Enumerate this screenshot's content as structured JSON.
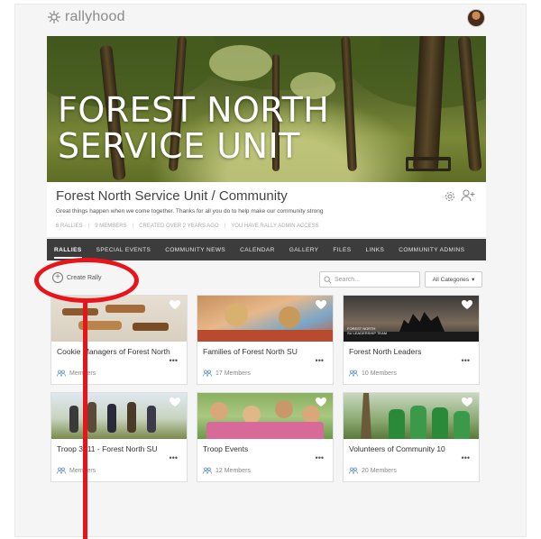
{
  "app": {
    "logo_text": "rallyhood"
  },
  "hero": {
    "line1": "FOREST NORTH",
    "line2": "SERVICE UNIT"
  },
  "community": {
    "title": "Forest North Service Unit / Community",
    "tagline": "Great things happen when we come together. Thanks for all you do to help make our community strong",
    "meta": [
      "6 RALLIES",
      "9 MEMBERS",
      "CREATED OVER 2 YEARS AGO",
      "YOU HAVE RALLY ADMIN ACCESS"
    ]
  },
  "tabs": [
    {
      "label": "RALLIES",
      "active": true
    },
    {
      "label": "SPECIAL EVENTS",
      "active": false
    },
    {
      "label": "COMMUNITY NEWS",
      "active": false
    },
    {
      "label": "CALENDAR",
      "active": false
    },
    {
      "label": "GALLERY",
      "active": false
    },
    {
      "label": "FILES",
      "active": false
    },
    {
      "label": "LINKS",
      "active": false
    },
    {
      "label": "COMMUNITY ADMINS",
      "active": false
    }
  ],
  "toolbar": {
    "create_label": "Create Rally",
    "search_placeholder": "Search...",
    "category_label": "All Categories"
  },
  "rallies": [
    {
      "name": "Cookie Managers of Forest North",
      "members": "Members"
    },
    {
      "name": "Families of Forest North SU",
      "members": "17 Members"
    },
    {
      "name": "Forest North Leaders",
      "members": "10 Members",
      "image_caption": "FOREST NORTH\nSU LEADERSHIP TEAM"
    },
    {
      "name": "Troop 3011 - Forest North SU",
      "members": "Members"
    },
    {
      "name": "Troop Events",
      "members": "12 Members"
    },
    {
      "name": "Volunteers of Community 10",
      "members": "20 Members"
    }
  ],
  "colors": {
    "tabbar": "#3c3c3c",
    "annotation": "#e8141b",
    "card_border": "#dedede"
  }
}
